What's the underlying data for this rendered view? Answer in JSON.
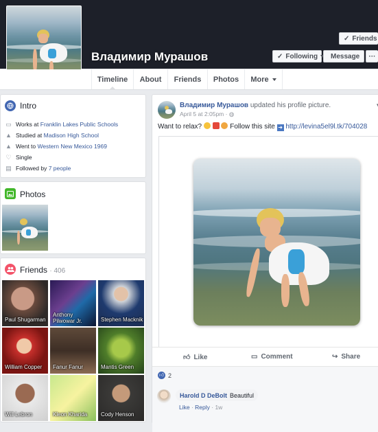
{
  "profile": {
    "name": "Владимир Мурашов",
    "buttons": {
      "friends": "Friends",
      "following": "Following",
      "message": "Message",
      "more": "···"
    }
  },
  "nav": {
    "tabs": [
      "Timeline",
      "About",
      "Friends",
      "Photos",
      "More"
    ]
  },
  "intro": {
    "title": "Intro",
    "items": [
      {
        "icon": "briefcase-icon",
        "prefix": "Works at ",
        "link": "Franklin Lakes Public Schools"
      },
      {
        "icon": "graduation-cap-icon",
        "prefix": "Studied at ",
        "link": "Madison High School"
      },
      {
        "icon": "graduation-cap-icon",
        "prefix": "Went to ",
        "link": "Western New Mexico 1969"
      },
      {
        "icon": "heart-icon",
        "prefix": "Single",
        "link": ""
      },
      {
        "icon": "rss-icon",
        "prefix": "Followed by ",
        "link": "7 people"
      }
    ]
  },
  "photos": {
    "title": "Photos"
  },
  "friends": {
    "title": "Friends",
    "count": "· 406",
    "list": [
      "Paul Shugarman",
      "Anthony Pilwowar Jr.",
      "Stephen Macknik",
      "William Copper",
      "Fanur Fanur",
      "Mantis Green",
      "Will Lebron",
      "Kleon Kharida",
      "Cody Henson"
    ]
  },
  "post": {
    "author": "Владимир Мурашов",
    "action": " updated his profile picture.",
    "time": "April 5 at 2:05pm",
    "privacy_sep": " · ",
    "text_before": "Want to relax? ",
    "text_follow": " Follow this site ",
    "link": "http://levina5el9l.tk/704028",
    "actions": {
      "like": "Like",
      "comment": "Comment",
      "share": "Share"
    },
    "reactions_count": "2"
  },
  "comment": {
    "author": "Harold D DeBolt",
    "text": "Beautiful",
    "like": "Like",
    "reply": "Reply",
    "sep": " · ",
    "time": "1w"
  },
  "colors": {
    "brand": "#365899",
    "cover": "#1d2029",
    "bg": "#e9ebee"
  }
}
